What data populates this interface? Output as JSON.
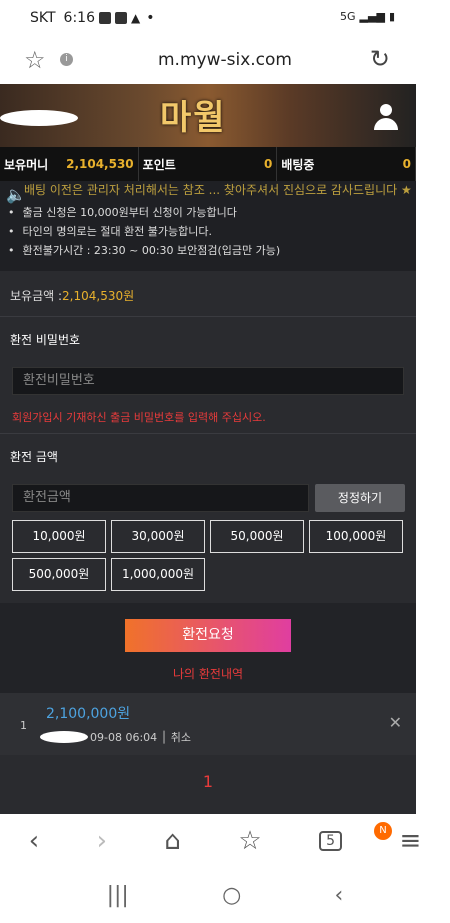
{
  "status": {
    "carrier": "SKT",
    "time": "6:16",
    "net": "5G"
  },
  "browser": {
    "url": "m.myw-six.com"
  },
  "site": {
    "logo": "마월",
    "stats": [
      {
        "label": "보유머니",
        "value": "2,104,530"
      },
      {
        "label": "포인트",
        "value": "0"
      },
      {
        "label": "배팅중",
        "value": "0"
      }
    ],
    "marquee": "배팅 이전은 관리자 처리해서는 참조 ... 찾아주셔서 진심으로 감사드립니다 ★",
    "notices": [
      "출금 신청은 10,000원부터 신청이 가능합니다",
      "타인의 명의로는 절대 환전 불가능합니다.",
      "환전불가시간 : 23:30 ~ 00:30 보안점검(입금만 가능)"
    ],
    "balance_label": "보유금액 : ",
    "balance_value": "2,104,530원",
    "password_section": {
      "title": "환전 비밀번호",
      "placeholder": "환전비밀번호",
      "warning": "회원가입시 기재하신 출금 비밀번호를 입력해 주십시오."
    },
    "amount_section": {
      "title": "환전 금액",
      "placeholder": "환전금액",
      "fix_label": "정정하기",
      "amounts": [
        "10,000원",
        "30,000원",
        "50,000원",
        "100,000원",
        "500,000원",
        "1,000,000원"
      ]
    },
    "submit_label": "환전요청",
    "history_link": "나의 환전내역",
    "history": [
      {
        "index": "1",
        "amount": "2,100,000원",
        "date": "09-08 06:04",
        "cancel": "취소"
      }
    ],
    "page": "1"
  },
  "nav": {
    "tabs_count": "5",
    "badge": "N"
  }
}
